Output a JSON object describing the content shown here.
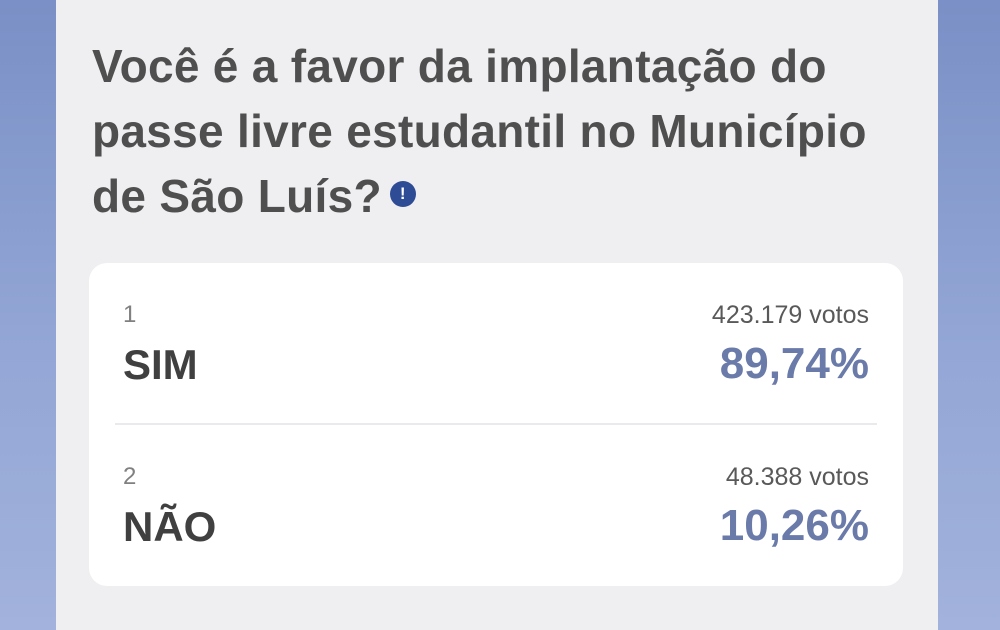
{
  "poll": {
    "question": "Você é a favor da implantação do passe livre estudantil no Município de São Luís?",
    "info_icon": "info-icon",
    "options": [
      {
        "index": "1",
        "label": "SIM",
        "votes": "423.179 votos",
        "percent": "89,74%"
      },
      {
        "index": "2",
        "label": "NÃO",
        "votes": "48.388 votos",
        "percent": "10,26%"
      }
    ]
  },
  "colors": {
    "background": "#8ea2d3",
    "panel": "#efeff2",
    "card": "#ffffff",
    "percent": "#6a7aa9",
    "info_icon": "#2e4c95"
  }
}
